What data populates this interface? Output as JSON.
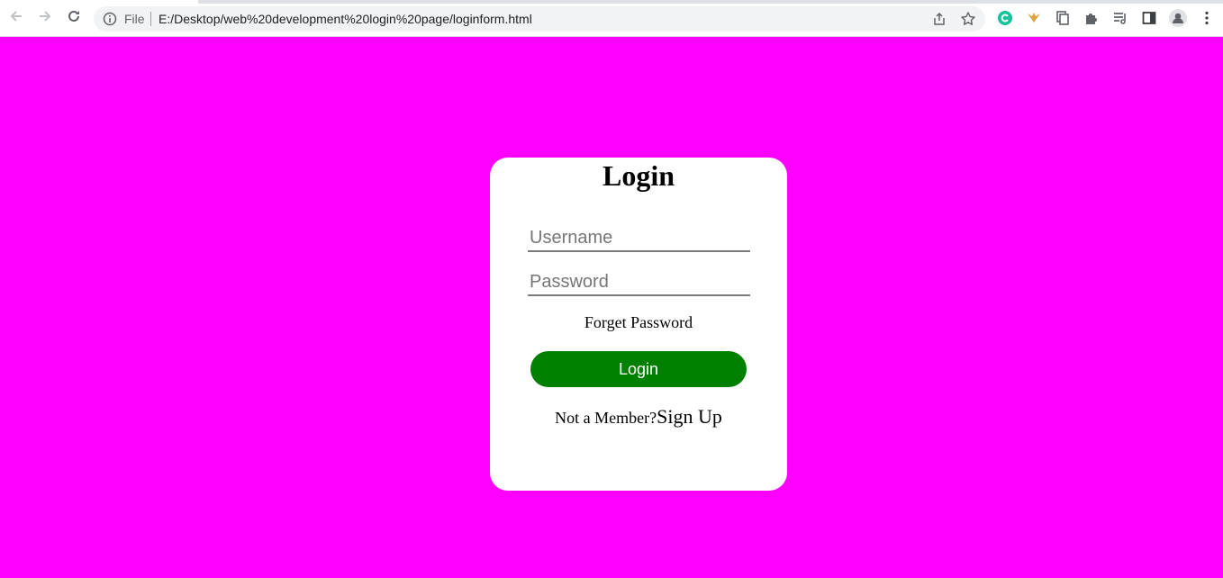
{
  "browser": {
    "omnibox": {
      "scheme_label": "File",
      "url": "E:/Desktop/web%20development%20login%20page/loginform.html"
    },
    "icons": {
      "back": "arrow-left-icon",
      "forward": "arrow-right-icon",
      "reload": "reload-icon",
      "info": "info-icon",
      "share": "share-icon",
      "bookmark": "star-icon",
      "extensions": [
        "grammarly-icon",
        "wings-extension-icon",
        "copy-extension-icon",
        "puzzle-icon",
        "reading-list-icon",
        "side-panel-icon",
        "profile-avatar-icon",
        "kebab-menu-icon"
      ]
    }
  },
  "colors": {
    "page_background": "#ff00ff",
    "card_background": "#ffffff",
    "login_button": "#008000"
  },
  "login_form": {
    "title": "Login",
    "username_placeholder": "Username",
    "password_placeholder": "Password",
    "forget_password": "Forget Password",
    "login_button": "Login",
    "signup_prompt": "Not a Member?",
    "signup_link": "Sign Up"
  }
}
